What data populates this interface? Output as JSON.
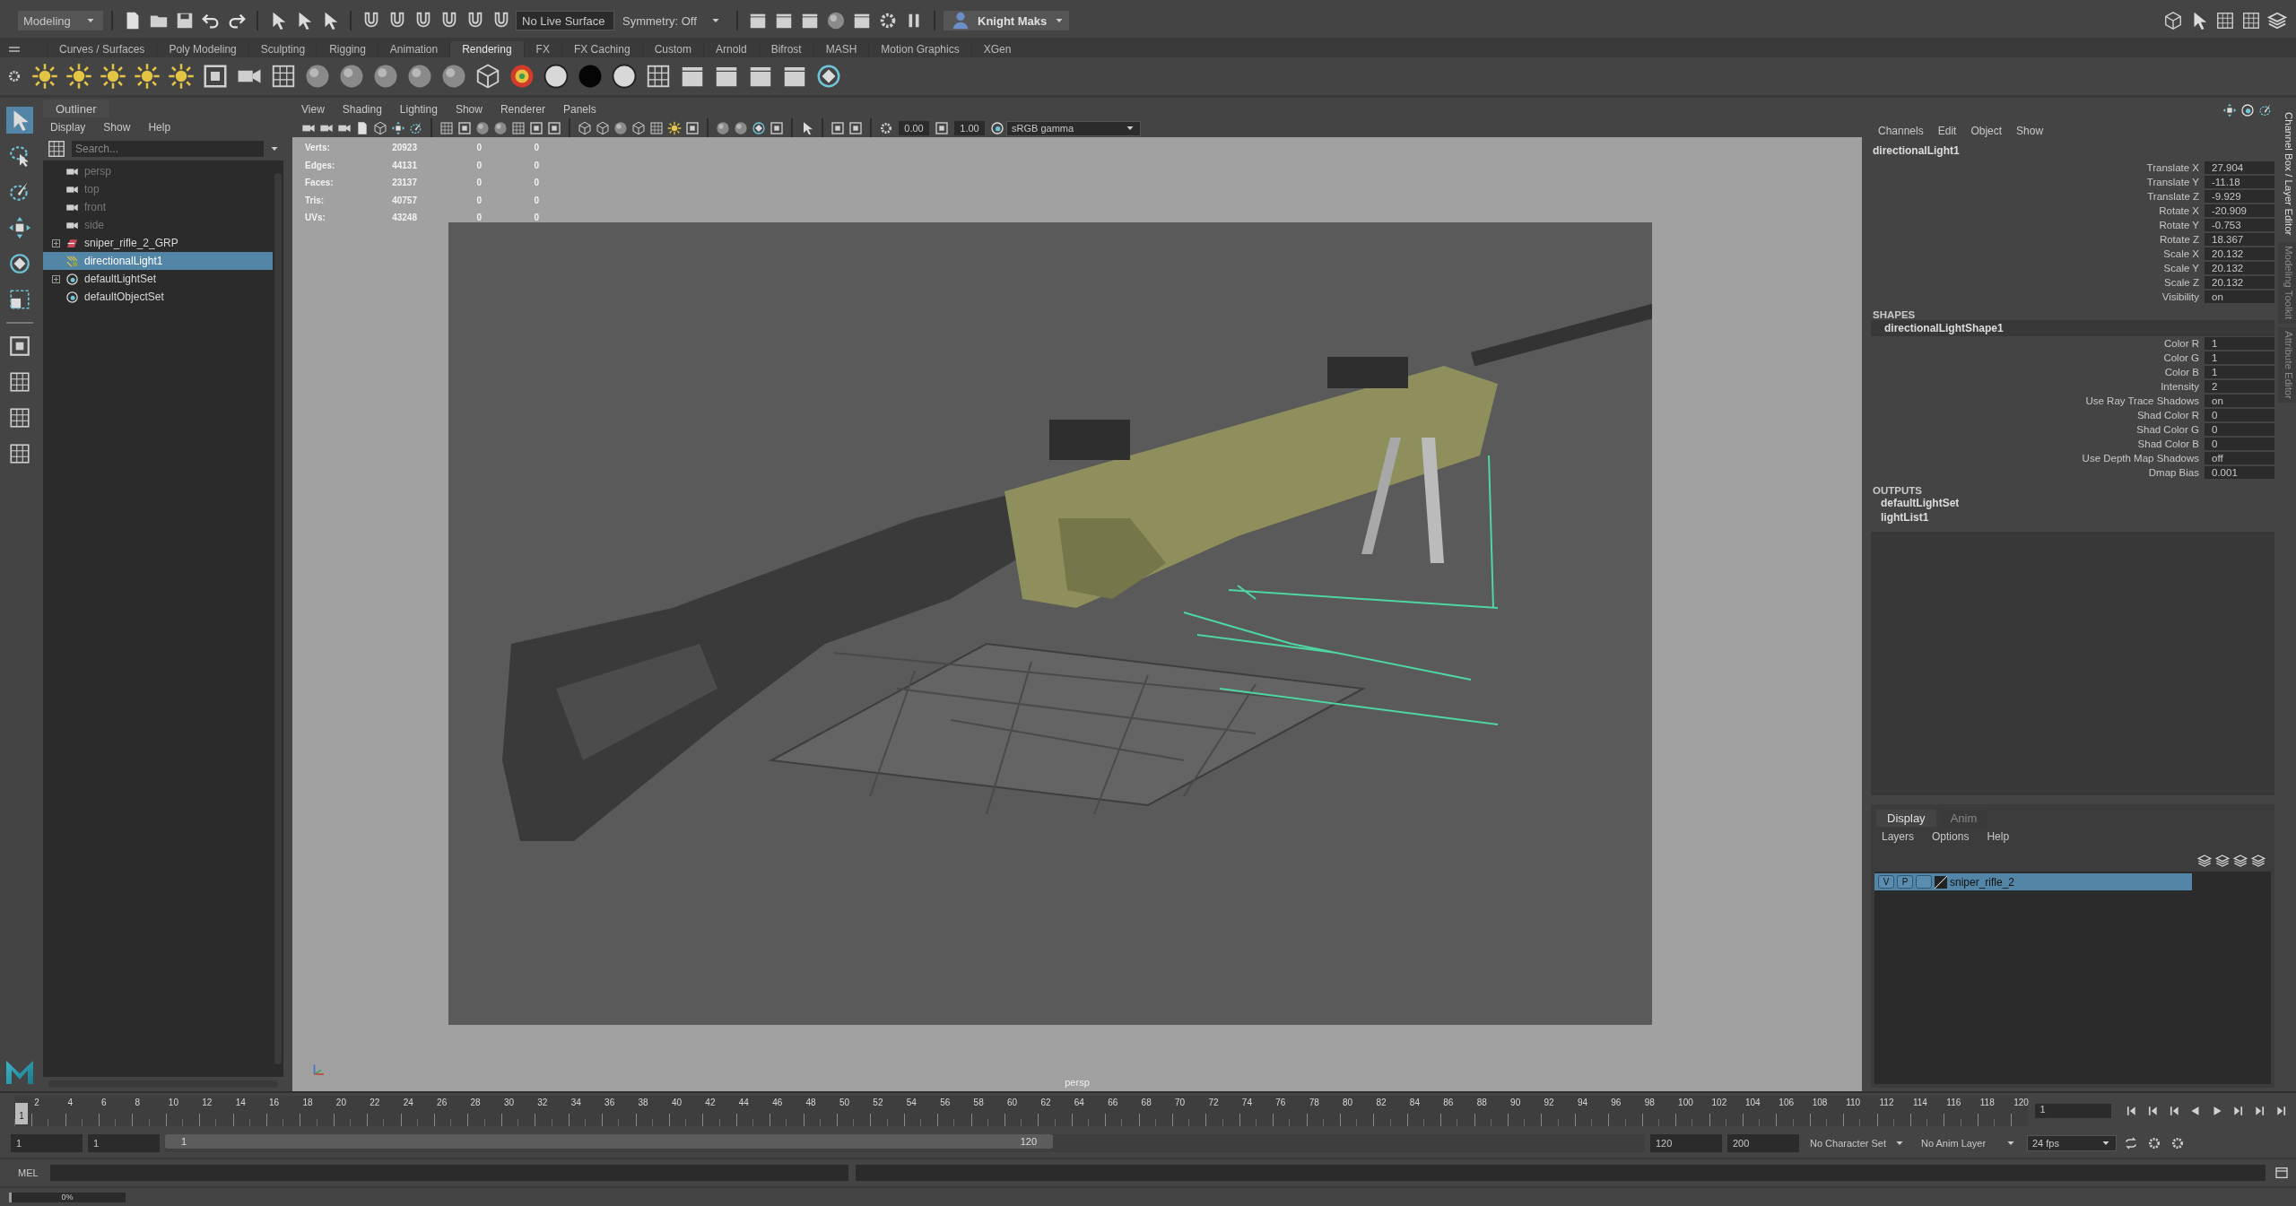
{
  "status_line": {
    "mode": "Modeling",
    "live_surface": "No Live Surface",
    "symmetry": "Symmetry: Off",
    "user": "Knight Maks"
  },
  "shelf": {
    "tabs": [
      {
        "label": "Curves / Surfaces",
        "selected": false
      },
      {
        "label": "Poly Modeling",
        "selected": false
      },
      {
        "label": "Sculpting",
        "selected": false
      },
      {
        "label": "Rigging",
        "selected": false
      },
      {
        "label": "Animation",
        "selected": false
      },
      {
        "label": "Rendering",
        "selected": true
      },
      {
        "label": "FX",
        "selected": false
      },
      {
        "label": "FX Caching",
        "selected": false
      },
      {
        "label": "Custom",
        "selected": false
      },
      {
        "label": "Arnold",
        "selected": false
      },
      {
        "label": "Bifrost",
        "selected": false
      },
      {
        "label": "MASH",
        "selected": false
      },
      {
        "label": "Motion Graphics",
        "selected": false
      },
      {
        "label": "XGen",
        "selected": false
      }
    ]
  },
  "outliner": {
    "title": "Outliner",
    "menu": [
      "Display",
      "Show",
      "Help"
    ],
    "search": {
      "placeholder": "Search..."
    },
    "items": [
      {
        "label": "persp",
        "kind": "camera",
        "dimmed": true,
        "expandable": false,
        "selected": false
      },
      {
        "label": "top",
        "kind": "camera",
        "dimmed": true,
        "expandable": false,
        "selected": false
      },
      {
        "label": "front",
        "kind": "camera",
        "dimmed": true,
        "expandable": false,
        "selected": false
      },
      {
        "label": "side",
        "kind": "camera",
        "dimmed": true,
        "expandable": false,
        "selected": false
      },
      {
        "label": "sniper_rifle_2_GRP",
        "kind": "group",
        "dimmed": false,
        "expandable": true,
        "selected": false
      },
      {
        "label": "directionalLight1",
        "kind": "light",
        "dimmed": false,
        "expandable": false,
        "selected": true
      },
      {
        "label": "defaultLightSet",
        "kind": "set",
        "dimmed": false,
        "expandable": true,
        "selected": false
      },
      {
        "label": "defaultObjectSet",
        "kind": "set",
        "dimmed": false,
        "expandable": false,
        "selected": false
      }
    ]
  },
  "viewport": {
    "menu": [
      "View",
      "Shading",
      "Lighting",
      "Show",
      "Renderer",
      "Panels"
    ],
    "exposure": "0.00",
    "gamma": "1.00",
    "color_space": "sRGB gamma",
    "hud": [
      {
        "label": "Verts:",
        "values": [
          "20923",
          "0",
          "0"
        ]
      },
      {
        "label": "Edges:",
        "values": [
          "44131",
          "0",
          "0"
        ]
      },
      {
        "label": "Faces:",
        "values": [
          "23137",
          "0",
          "0"
        ]
      },
      {
        "label": "Tris:",
        "values": [
          "40757",
          "0",
          "0"
        ]
      },
      {
        "label": "UVs:",
        "values": [
          "43248",
          "0",
          "0"
        ]
      }
    ],
    "camera": "persp"
  },
  "channel_box": {
    "menu": [
      "Channels",
      "Edit",
      "Object",
      "Show"
    ],
    "node": "directionalLight1",
    "channels": [
      {
        "label": "Translate X",
        "value": "27.904"
      },
      {
        "label": "Translate Y",
        "value": "-11.18"
      },
      {
        "label": "Translate Z",
        "value": "-9.929"
      },
      {
        "label": "Rotate X",
        "value": "-20.909"
      },
      {
        "label": "Rotate Y",
        "value": "-0.753"
      },
      {
        "label": "Rotate Z",
        "value": "18.367"
      },
      {
        "label": "Scale X",
        "value": "20.132"
      },
      {
        "label": "Scale Y",
        "value": "20.132"
      },
      {
        "label": "Scale Z",
        "value": "20.132"
      },
      {
        "label": "Visibility",
        "value": "on"
      }
    ],
    "shapes_header": "SHAPES",
    "shape": "directionalLightShape1",
    "shape_channels": [
      {
        "label": "Color R",
        "value": "1"
      },
      {
        "label": "Color G",
        "value": "1"
      },
      {
        "label": "Color B",
        "value": "1"
      },
      {
        "label": "Intensity",
        "value": "2"
      },
      {
        "label": "Use Ray Trace Shadows",
        "value": "on"
      },
      {
        "label": "Shad Color R",
        "value": "0"
      },
      {
        "label": "Shad Color G",
        "value": "0"
      },
      {
        "label": "Shad Color B",
        "value": "0"
      },
      {
        "label": "Use Depth Map Shadows",
        "value": "off"
      },
      {
        "label": "Dmap Bias",
        "value": "0.001"
      }
    ],
    "outputs_header": "OUTPUTS",
    "outputs": [
      "defaultLightSet",
      "lightList1"
    ]
  },
  "side_tabs": [
    {
      "label": "Channel Box / Layer Editor",
      "selected": true
    },
    {
      "label": "Modeling Toolkit",
      "selected": false
    },
    {
      "label": "Attribute Editor",
      "selected": false
    }
  ],
  "layer_editor": {
    "tabs": [
      {
        "label": "Display",
        "selected": true
      },
      {
        "label": "Anim",
        "selected": false
      }
    ],
    "menu": [
      "Layers",
      "Options",
      "Help"
    ],
    "layers": [
      {
        "visibility": "V",
        "playback": "P",
        "name": "sniper_rifle_2",
        "selected": true
      }
    ]
  },
  "time_slider": {
    "level": 0,
    "current_frame": "1",
    "current_field": "1",
    "ticks": [
      "2",
      "4",
      "6",
      "8",
      "10",
      "12",
      "14",
      "16",
      "18",
      "20",
      "22",
      "24",
      "26",
      "28",
      "30",
      "32",
      "34",
      "36",
      "38",
      "40",
      "42",
      "44",
      "46",
      "48",
      "50",
      "52",
      "54",
      "56",
      "58",
      "60",
      "62",
      "64",
      "66",
      "68",
      "70",
      "72",
      "74",
      "76",
      "78",
      "80",
      "82",
      "84",
      "86",
      "88",
      "90",
      "92",
      "94",
      "96",
      "98",
      "100",
      "102",
      "104",
      "106",
      "108",
      "110",
      "112",
      "114",
      "116",
      "118",
      "120"
    ]
  },
  "range_slider": {
    "level": 0.6,
    "start": "1",
    "playback_start": "1",
    "slider_start": "1",
    "slider_end": "120",
    "playback_end": "120",
    "end": "200",
    "character_set": "No Character Set",
    "anim_layer": "No Anim Layer",
    "fps": "24 fps"
  },
  "command_line": {
    "label": "MEL"
  },
  "help_line": {
    "level": 0.02,
    "progress": "0%"
  }
}
